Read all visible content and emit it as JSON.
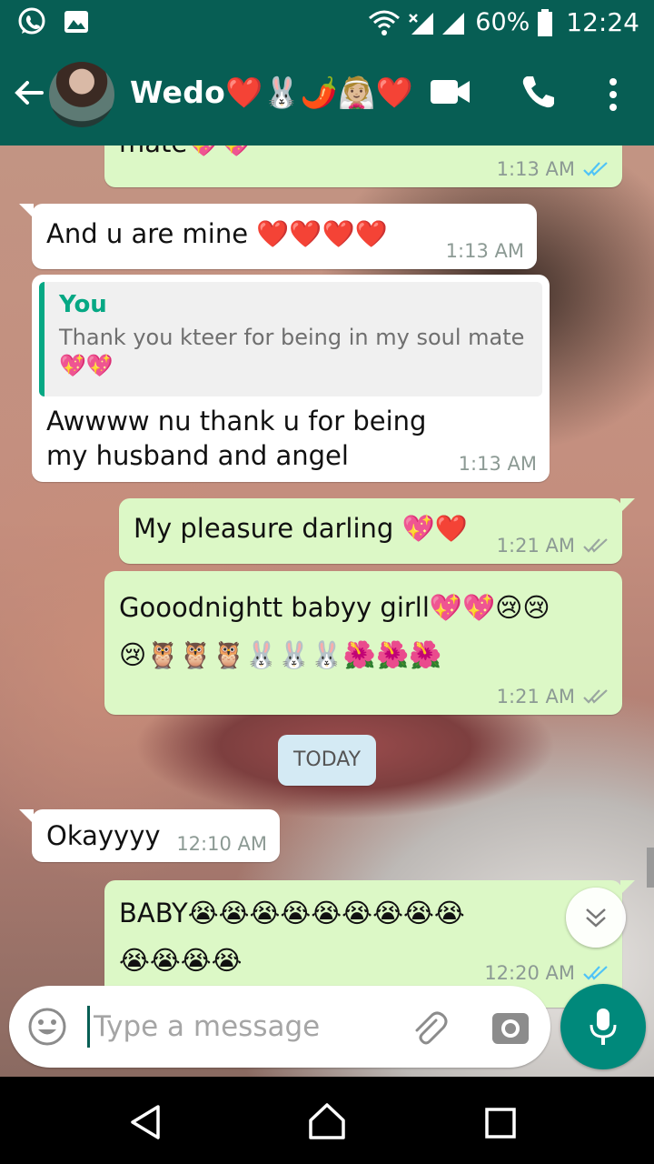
{
  "status_bar": {
    "battery": "60%",
    "time": "12:24",
    "icons": [
      "whatsapp-icon",
      "gallery-icon",
      "wifi-icon",
      "signal-icon",
      "battery-icon"
    ]
  },
  "header": {
    "contact_name": "Wedo❤️🐰🌶️👰🏼❤️",
    "icons": [
      "back-arrow-icon",
      "video-call-icon",
      "voice-call-icon",
      "menu-icon"
    ]
  },
  "messages": [
    {
      "direction": "out",
      "text": "mate💖💖",
      "time": "1:13 AM",
      "status": "read"
    },
    {
      "direction": "in",
      "text": "And u are mine ❤️❤️❤️❤️",
      "time": "1:13 AM"
    },
    {
      "direction": "in",
      "quote_author": "You",
      "quote_text": "Thank you kteer for being in my soul mate💖💖",
      "text": "Awwww nu thank u for being my husband and angel",
      "time": "1:13 AM"
    },
    {
      "direction": "out",
      "text": "My pleasure darling 💖❤️",
      "time": "1:21 AM",
      "status": "delivered"
    },
    {
      "direction": "out",
      "text": "Gooodnightt babyy girll💖💖😢😢\n😢🦉🦉🦉🐰🐰🐰🌺🌺🌺",
      "time": "1:21 AM",
      "status": "delivered"
    },
    {
      "direction": "in",
      "text": "Okayyyy",
      "time": "12:10 AM"
    },
    {
      "direction": "out",
      "text": "BABY😭😭😭😭😭😭😭😭😭\n😭😭😭😭",
      "time": "12:20 AM",
      "status": "read"
    }
  ],
  "date_divider": "TODAY",
  "composer": {
    "placeholder": "Type a message",
    "value": ""
  },
  "colors": {
    "header": "#075e54",
    "outgoing_bubble": "#dcf8c6",
    "incoming_bubble": "#ffffff",
    "read_tick": "#4fc3f7",
    "mic_button": "#00897b"
  }
}
